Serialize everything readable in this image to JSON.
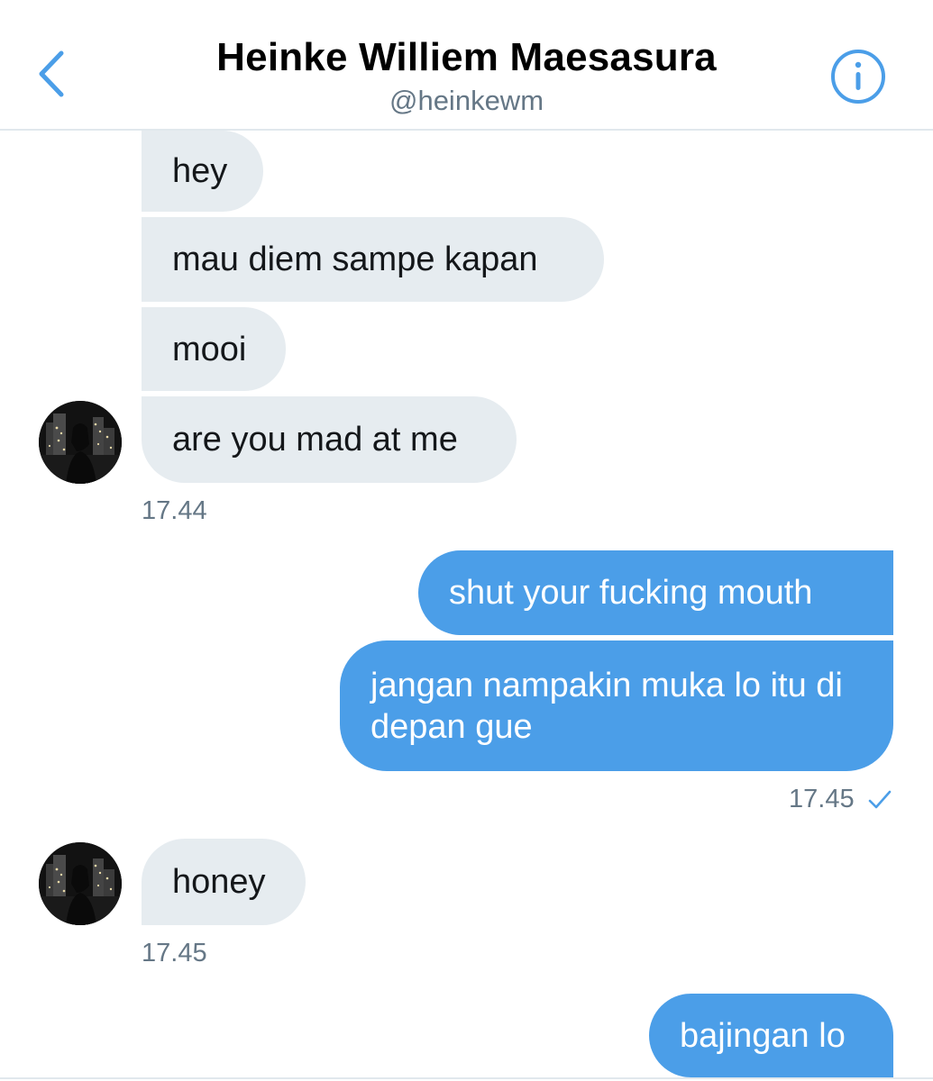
{
  "header": {
    "name": "Heinke Williem Maesasura",
    "handle": "@heinkewm"
  },
  "icons": {
    "back": "chevron-left-icon",
    "info": "info-circle-icon",
    "read": "checkmark-icon"
  },
  "colors": {
    "accent": "#4b9ee8",
    "incoming_bubble": "#e6ecf0",
    "muted_text": "#657786"
  },
  "messages": {
    "group1": {
      "m1": "hey",
      "m2": "mau diem sampe kapan",
      "m3": "mooi",
      "m4": "are you mad at me",
      "time": "17.44"
    },
    "group2": {
      "m1": "shut your fucking mouth",
      "m2": "jangan nampakin muka lo itu di depan gue",
      "time": "17.45"
    },
    "group3": {
      "m1": "honey",
      "time": "17.45"
    },
    "group4": {
      "m1": "bajingan lo"
    }
  }
}
